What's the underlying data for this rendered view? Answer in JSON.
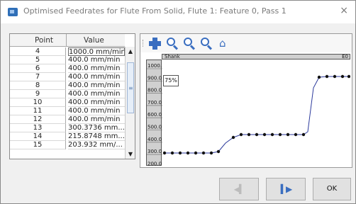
{
  "window": {
    "title": "Optimised Feedrates for Flute From Solid, Flute 1: Feature 0, Pass 1",
    "close": "×"
  },
  "table": {
    "headers": {
      "point": "Point",
      "value": "Value"
    },
    "rows": [
      {
        "point": "4",
        "value": "1000.0 mm/min"
      },
      {
        "point": "5",
        "value": "400.0 mm/min"
      },
      {
        "point": "6",
        "value": "400.0 mm/min"
      },
      {
        "point": "7",
        "value": "400.0 mm/min"
      },
      {
        "point": "8",
        "value": "400.0 mm/min"
      },
      {
        "point": "9",
        "value": "400.0 mm/min"
      },
      {
        "point": "10",
        "value": "400.0 mm/min"
      },
      {
        "point": "11",
        "value": "400.0 mm/min"
      },
      {
        "point": "12",
        "value": "400.0 mm/min"
      },
      {
        "point": "13",
        "value": "300.3736 mm..."
      },
      {
        "point": "14",
        "value": "215.8748 mm..."
      },
      {
        "point": "15",
        "value": "203.932 mm/..."
      }
    ]
  },
  "toolbar": {
    "icons": [
      "add-point-icon",
      "zoom-in-icon",
      "zoom-out-icon",
      "zoom-fit-icon",
      "home-view-icon"
    ]
  },
  "graph": {
    "x_ruler": {
      "left_label": "Shank",
      "right_label": "E0"
    },
    "y_ticks": [
      "1000.",
      "900.0",
      "800.0",
      "700.0",
      "600.0",
      "500.0",
      "400.0",
      "300.0",
      "200.0"
    ],
    "percent_label": "75%",
    "colors": {
      "line": "#2c3a9c",
      "point": "#111111"
    }
  },
  "buttons": {
    "prev": "◀▍",
    "next": "▍▶",
    "ok": "OK"
  }
}
